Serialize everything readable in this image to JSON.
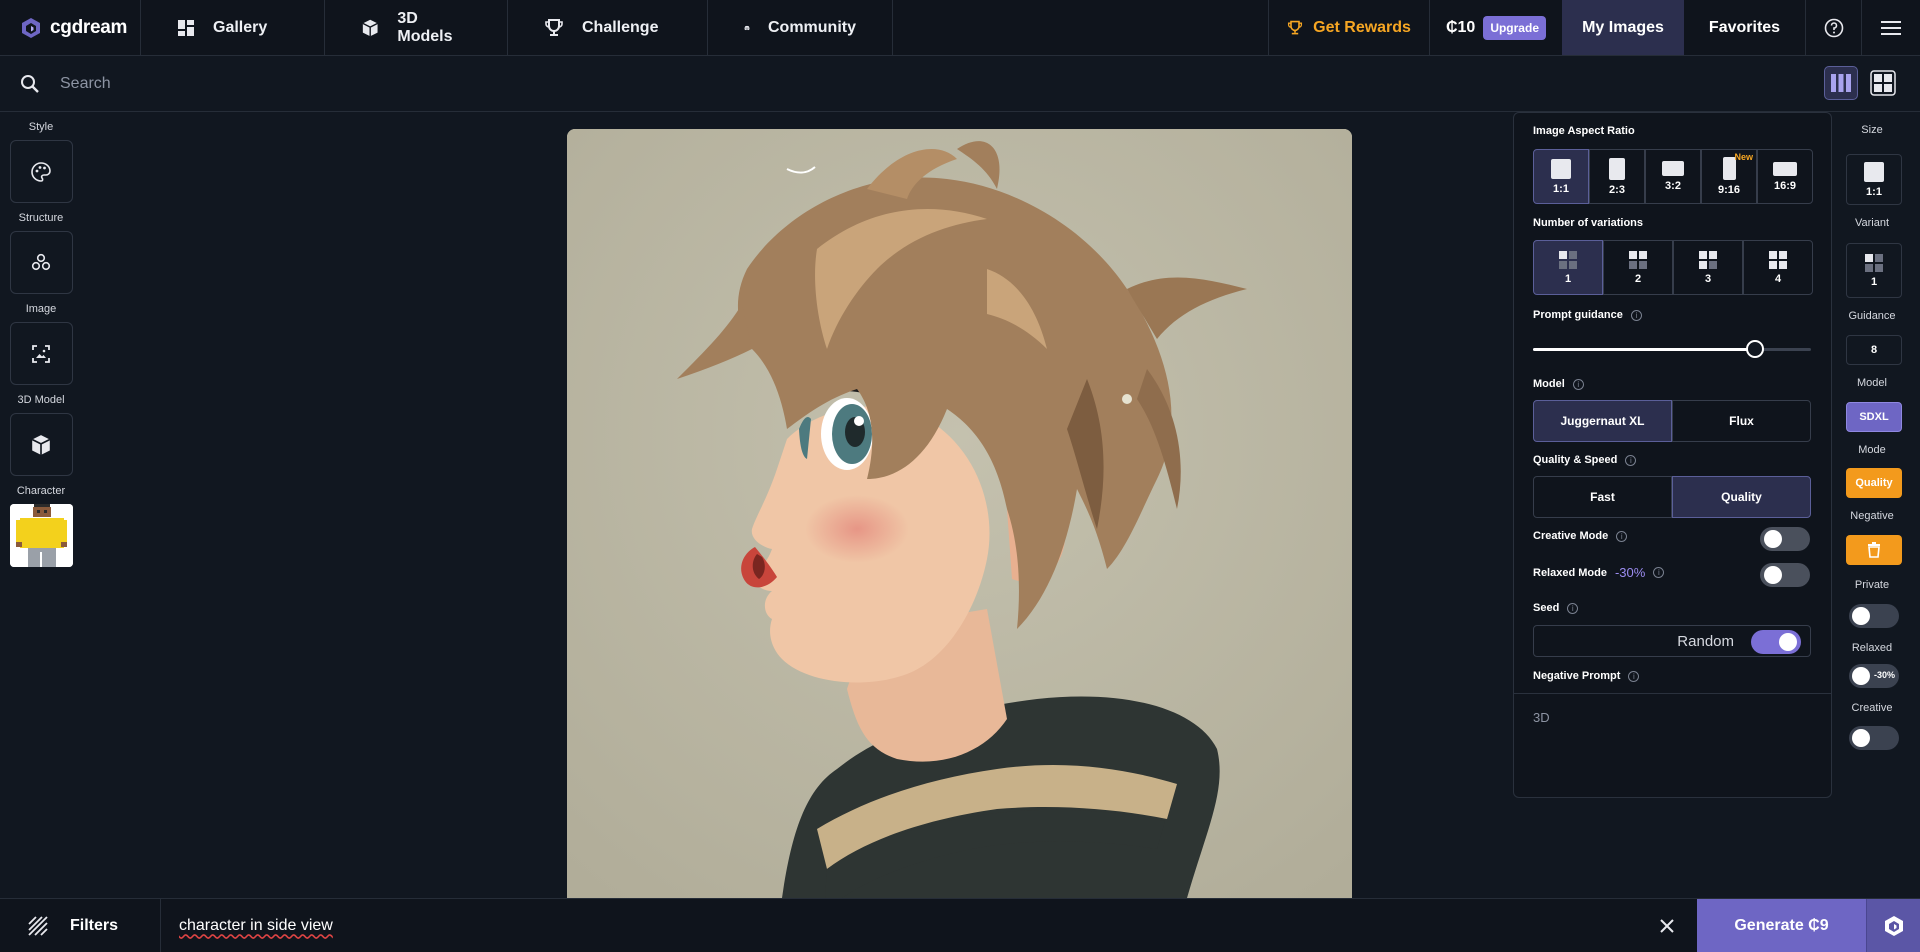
{
  "brand": {
    "name": "cgdream"
  },
  "nav": {
    "items": [
      {
        "label": "Gallery",
        "icon": "dashboard-icon"
      },
      {
        "label": "3D Models",
        "icon": "cube-icon"
      },
      {
        "label": "Challenge",
        "icon": "trophy-icon"
      },
      {
        "label": "Community",
        "icon": "discord-icon"
      }
    ],
    "rewards_label": "Get Rewards",
    "credits": "₵10",
    "upgrade_label": "Upgrade",
    "my_images_label": "My Images",
    "favorites_label": "Favorites"
  },
  "search": {
    "placeholder": "Search"
  },
  "left_tools": {
    "style_label": "Style",
    "structure_label": "Structure",
    "image_label": "Image",
    "model3d_label": "3D Model",
    "character_label": "Character"
  },
  "settings": {
    "aspect_title": "Image Aspect Ratio",
    "aspect_options": [
      "1:1",
      "2:3",
      "3:2",
      "9:16",
      "16:9"
    ],
    "aspect_selected": "1:1",
    "new_tag": "New",
    "variations_title": "Number of variations",
    "variation_options": [
      "1",
      "2",
      "3",
      "4"
    ],
    "variation_selected": "1",
    "guidance_title": "Prompt guidance",
    "guidance_value": 8,
    "guidance_max": 10,
    "model_title": "Model",
    "model_options": [
      "Juggernaut XL",
      "Flux"
    ],
    "model_selected": "Juggernaut XL",
    "quality_title": "Quality & Speed",
    "quality_options": [
      "Fast",
      "Quality"
    ],
    "quality_selected": "Quality",
    "creative_title": "Creative Mode",
    "creative_on": false,
    "relaxed_title": "Relaxed Mode",
    "relaxed_discount": "-30%",
    "relaxed_on": false,
    "seed_title": "Seed",
    "seed_value": "Random",
    "seed_random_on": true,
    "negative_title": "Negative Prompt",
    "negative_value": "3D"
  },
  "right_column": {
    "size_label": "Size",
    "size_value": "1:1",
    "variant_label": "Variant",
    "variant_value": "1",
    "guidance_label": "Guidance",
    "guidance_value": "8",
    "model_label": "Model",
    "model_value": "SDXL",
    "mode_label": "Mode",
    "mode_value": "Quality",
    "negative_label": "Negative",
    "private_label": "Private",
    "relaxed_label": "Relaxed",
    "relaxed_pct": "-30%",
    "creative_label": "Creative"
  },
  "bottom": {
    "filters_label": "Filters",
    "prompt_value": "character in side view",
    "generate_label": "Generate ₵9"
  },
  "colors": {
    "accent": "#7b6fd6",
    "selected_bg": "#2c2f4e",
    "orange": "#f6a623",
    "background": "#111720"
  }
}
